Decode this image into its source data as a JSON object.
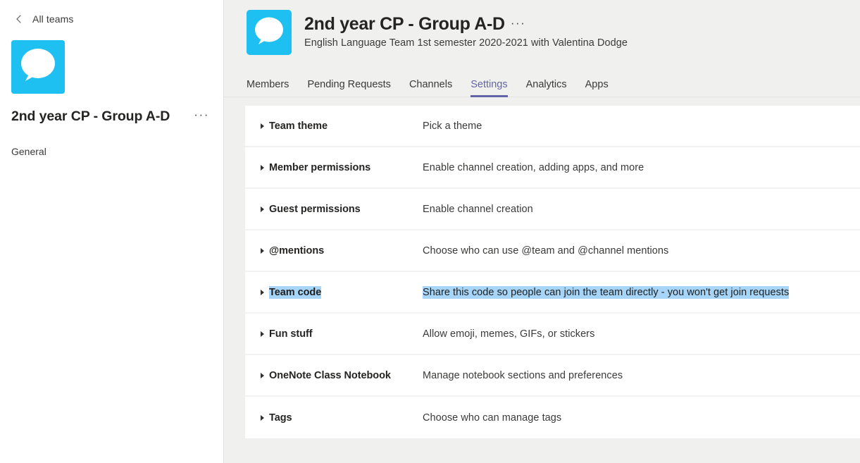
{
  "sidebar": {
    "back_label": "All teams",
    "back_icon": "chevron-left-icon",
    "avatar_icon": "speech-bubble-avatar",
    "team_name": "2nd year CP - Group A-D",
    "more_options_label": "···",
    "channels": [
      {
        "label": "General"
      }
    ]
  },
  "header": {
    "avatar_icon": "speech-bubble-avatar",
    "title": "2nd year CP - Group A-D",
    "title_more_label": "···",
    "subtitle": "English Language Team 1st semester 2020-2021 with Valentina Dodge"
  },
  "tabs": [
    {
      "label": "Members",
      "active": false
    },
    {
      "label": "Pending Requests",
      "active": false
    },
    {
      "label": "Channels",
      "active": false
    },
    {
      "label": "Settings",
      "active": true
    },
    {
      "label": "Analytics",
      "active": false
    },
    {
      "label": "Apps",
      "active": false
    }
  ],
  "settings": [
    {
      "label": "Team theme",
      "desc": "Pick a theme",
      "selected": false
    },
    {
      "label": "Member permissions",
      "desc": "Enable channel creation, adding apps, and more",
      "selected": false
    },
    {
      "label": "Guest permissions",
      "desc": "Enable channel creation",
      "selected": false
    },
    {
      "label": "@mentions",
      "desc": "Choose who can use @team and @channel mentions",
      "selected": false
    },
    {
      "label": "Team code",
      "desc": "Share this code so people can join the team directly - you won't get join requests",
      "selected": true
    },
    {
      "label": "Fun stuff",
      "desc": "Allow emoji, memes, GIFs, or stickers",
      "selected": false
    },
    {
      "label": "OneNote Class Notebook",
      "desc": "Manage notebook sections and preferences",
      "selected": false
    },
    {
      "label": "Tags",
      "desc": "Choose who can manage tags",
      "selected": false
    }
  ],
  "colors": {
    "accent_purple": "#6264a7",
    "avatar_cyan": "#1ec0f2",
    "selection_blue": "#a6d5f7",
    "page_gray": "#f0f0ef"
  }
}
